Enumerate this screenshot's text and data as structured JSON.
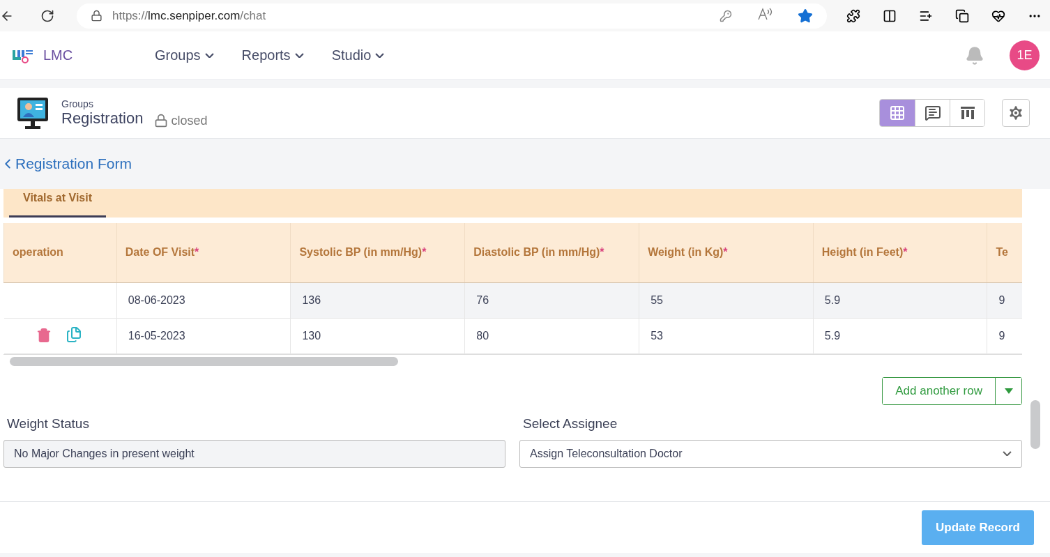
{
  "browser": {
    "url": {
      "scheme": "https://",
      "host": "lmc.senpiper.com",
      "path": "/chat"
    },
    "favorite": true
  },
  "nav": {
    "brand": "LMC",
    "menus": [
      "Groups",
      "Reports",
      "Studio"
    ],
    "avatar": "1E"
  },
  "header": {
    "breadcrumb": "Groups",
    "title": "Registration",
    "status": "closed",
    "views": [
      {
        "kind": "grid",
        "selected": true
      },
      {
        "kind": "chat",
        "selected": false
      },
      {
        "kind": "columns",
        "selected": false
      }
    ]
  },
  "back_link": "Registration Form",
  "tabs": [
    {
      "label": "Vitals at Visit",
      "selected": true
    }
  ],
  "table": {
    "columns": [
      {
        "label": "operation",
        "required": false
      },
      {
        "label": "Date OF Visit",
        "required": true
      },
      {
        "label": "Systolic BP (in mm/Hg)",
        "required": true
      },
      {
        "label": "Diastolic BP (in mm/Hg)",
        "required": true
      },
      {
        "label": "Weight (in Kg)",
        "required": true
      },
      {
        "label": "Height (in Feet)",
        "required": true
      },
      {
        "label": "Te",
        "required": false
      }
    ],
    "required_mark": "*",
    "rows": [
      {
        "actions": false,
        "highlighted": true,
        "cells": [
          "",
          "08-06-2023",
          "136",
          "76",
          "55",
          "5.9",
          "9"
        ]
      },
      {
        "actions": true,
        "highlighted": false,
        "cells": [
          "",
          "16-05-2023",
          "130",
          "80",
          "53",
          "5.9",
          "9"
        ]
      }
    ]
  },
  "add_row_button": "Add another row",
  "fields": [
    {
      "kind": "textarea",
      "label": "Weight Status",
      "value": "No Major Changes in present weight"
    },
    {
      "kind": "select",
      "label": "Select Assignee",
      "value": "Assign Teleconsultation Doctor"
    }
  ],
  "submit_button": "Update Record"
}
